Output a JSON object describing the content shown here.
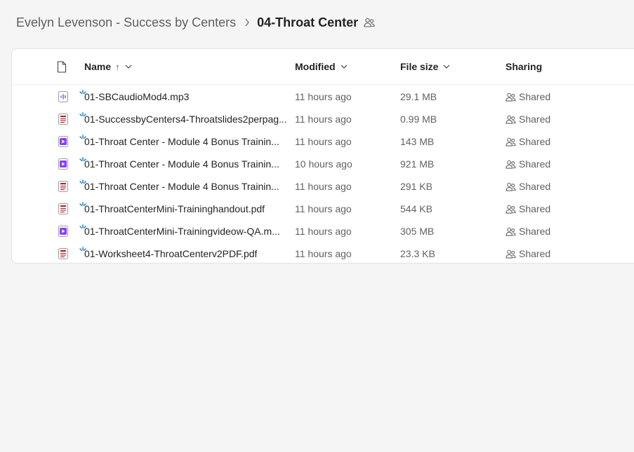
{
  "breadcrumb": {
    "parent": "Evelyn Levenson - Success by Centers",
    "current": "04-Throat Center"
  },
  "columns": {
    "name": "Name",
    "name_sort": "↑",
    "modified": "Modified",
    "file_size": "File size",
    "sharing": "Sharing"
  },
  "files": [
    {
      "type": "audio",
      "name": "01-SBCaudioMod4.mp3",
      "modified": "11 hours ago",
      "size": "29.1 MB",
      "sharing": "Shared"
    },
    {
      "type": "pdf",
      "name": "01-SuccessbyCenters4-Throatslides2perpag...",
      "modified": "11 hours ago",
      "size": "0.99 MB",
      "sharing": "Shared"
    },
    {
      "type": "video",
      "name": "01-Throat Center - Module 4 Bonus Trainin...",
      "modified": "11 hours ago",
      "size": "143 MB",
      "sharing": "Shared"
    },
    {
      "type": "video",
      "name": "01-Throat Center - Module 4 Bonus Trainin...",
      "modified": "10 hours ago",
      "size": "921 MB",
      "sharing": "Shared"
    },
    {
      "type": "pdf",
      "name": "01-Throat Center - Module 4 Bonus Trainin...",
      "modified": "11 hours ago",
      "size": "291 KB",
      "sharing": "Shared"
    },
    {
      "type": "pdf",
      "name": "01-ThroatCenterMini-Traininghandout.pdf",
      "modified": "11 hours ago",
      "size": "544 KB",
      "sharing": "Shared"
    },
    {
      "type": "video",
      "name": "01-ThroatCenterMini-Trainingvideow-QA.m...",
      "modified": "11 hours ago",
      "size": "305 MB",
      "sharing": "Shared"
    },
    {
      "type": "pdf",
      "name": "01-Worksheet4-ThroatCenterv2PDF.pdf",
      "modified": "11 hours ago",
      "size": "23.3 KB",
      "sharing": "Shared"
    }
  ],
  "colors": {
    "media_purple": "#8a3ffc",
    "pdf_red": "#b4232a",
    "new_blue": "#1479c9"
  }
}
